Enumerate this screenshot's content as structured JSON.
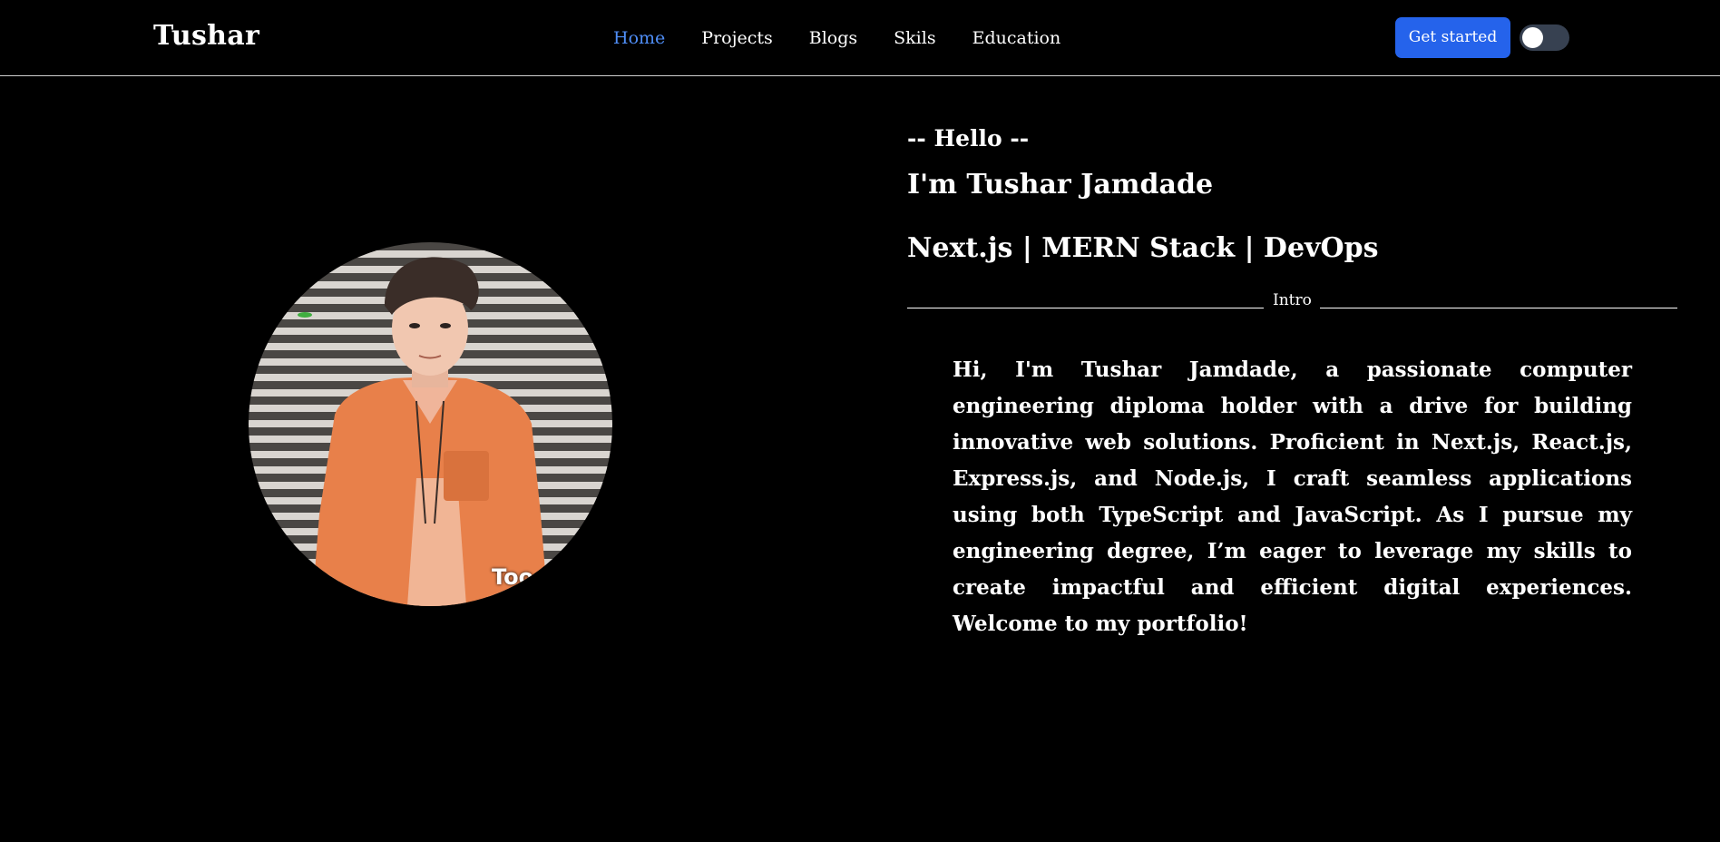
{
  "navbar": {
    "brand": "Tushar",
    "links": [
      {
        "label": "Home",
        "active": true
      },
      {
        "label": "Projects",
        "active": false
      },
      {
        "label": "Blogs",
        "active": false
      },
      {
        "label": "Skils",
        "active": false
      },
      {
        "label": "Education",
        "active": false
      }
    ],
    "cta_label": "Get started",
    "theme_toggle": {
      "state": "off"
    }
  },
  "hero": {
    "avatar": {
      "icon": "profile-photo",
      "caption": "Too"
    },
    "hello": "-- Hello --",
    "name": "I'm Tushar Jamdade",
    "tagline": "Next.js | MERN Stack | DevOps",
    "divider_label": "Intro",
    "bio": "Hi, I'm Tushar Jamdade, a passionate computer engineering diploma holder with a drive for building innovative web solutions. Proficient in Next.js, React.js, Express.js, and Node.js, I craft seamless applications using both TypeScript and JavaScript. As I pursue my engineering degree, I’m eager to leverage my skills to create impactful and efficient digital experiences. Welcome to my portfolio!"
  },
  "colors": {
    "background": "#000000",
    "text": "#ffffff",
    "accent": "#2563eb",
    "active_link": "#4f8ef7",
    "toggle_track": "#374151"
  }
}
